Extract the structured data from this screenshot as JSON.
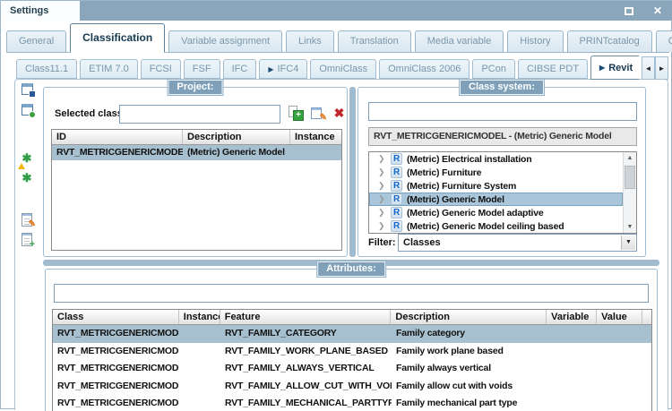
{
  "window": {
    "title": "Settings"
  },
  "icons": {
    "close": "✕",
    "tab_arrow": "▶",
    "scroll_left": "◄",
    "scroll_right": "►",
    "tree_expander": "❯",
    "revit_badge": "R",
    "scroll_up": "▲",
    "scroll_down": "▼",
    "combo_arrow": "▼",
    "delete": "✖",
    "pencil": "✎",
    "clover": "✱",
    "plus": "+"
  },
  "colors": {
    "titlebar": "#8aa6ba",
    "panel_badge": "#7fa0b8",
    "selection": "#a7c0cf",
    "revit_blue": "#1467c8",
    "add_green": "#35a13f",
    "delete_red": "#c0272d",
    "warning_yellow": "#f2b705",
    "pencil_orange": "#e07a1f"
  },
  "main_tabs": {
    "items": [
      {
        "label": "General"
      },
      {
        "label": "Classification",
        "active": true
      },
      {
        "label": "Variable assignment"
      },
      {
        "label": "Links"
      },
      {
        "label": "Translation"
      },
      {
        "label": "Media variable"
      },
      {
        "label": "History"
      },
      {
        "label": "PRINTcatalog"
      },
      {
        "label": "QA check"
      }
    ]
  },
  "sub_tabs": {
    "items": [
      {
        "label": "Class11.1"
      },
      {
        "label": "ETIM 7.0"
      },
      {
        "label": "FCSI"
      },
      {
        "label": "FSF"
      },
      {
        "label": "IFC"
      },
      {
        "label": "IFC4",
        "arrow": true
      },
      {
        "label": "OmniClass"
      },
      {
        "label": "OmniClass 2006"
      },
      {
        "label": "PCon"
      },
      {
        "label": "CIBSE PDT"
      },
      {
        "label": "Revit",
        "arrow": true,
        "active": true
      }
    ]
  },
  "project": {
    "title": "Project:",
    "selected_classes_label": "Selected classes",
    "selected_classes_value": "",
    "table": {
      "headers": [
        "ID",
        "Description",
        "Instance"
      ],
      "rows": [
        {
          "id": "RVT_METRICGENERICMODEL",
          "description": "(Metric) Generic Model",
          "instance": "",
          "selected": true
        }
      ]
    }
  },
  "class_system": {
    "title": "Class system:",
    "search_value": "",
    "selected_display": "RVT_METRICGENERICMODEL - (Metric) Generic Model",
    "tree_items": [
      {
        "label": "(Metric) Electrical installation"
      },
      {
        "label": "(Metric) Furniture"
      },
      {
        "label": "(Metric) Furniture System"
      },
      {
        "label": "(Metric) Generic Model",
        "selected": true
      },
      {
        "label": "(Metric) Generic Model adaptive"
      },
      {
        "label": "(Metric) Generic Model ceiling based"
      }
    ],
    "filter_label": "Filter:",
    "filter_value": "Classes"
  },
  "attributes": {
    "title": "Attributes:",
    "filter_value": "",
    "table": {
      "headers": [
        "Class",
        "Instance",
        "Feature",
        "Description",
        "Variable",
        "Value"
      ],
      "rows": [
        {
          "class": "RVT_METRICGENERICMODEL",
          "instance": "",
          "feature": "RVT_FAMILY_CATEGORY",
          "description": "Family category",
          "variable": "",
          "value": "",
          "selected": true
        },
        {
          "class": "RVT_METRICGENERICMODEL",
          "instance": "",
          "feature": "RVT_FAMILY_WORK_PLANE_BASED",
          "description": "Family work plane based",
          "variable": "",
          "value": ""
        },
        {
          "class": "RVT_METRICGENERICMODEL",
          "instance": "",
          "feature": "RVT_FAMILY_ALWAYS_VERTICAL",
          "description": "Family always vertical",
          "variable": "",
          "value": ""
        },
        {
          "class": "RVT_METRICGENERICMODEL",
          "instance": "",
          "feature": "RVT_FAMILY_ALLOW_CUT_WITH_VOIDS",
          "description": "Family allow cut with voids",
          "variable": "",
          "value": ""
        },
        {
          "class": "RVT_METRICGENERICMODEL",
          "instance": "",
          "feature": "RVT_FAMILY_MECHANICAL_PARTTYPE",
          "description": "Family mechanical part type",
          "variable": "",
          "value": ""
        }
      ]
    }
  }
}
